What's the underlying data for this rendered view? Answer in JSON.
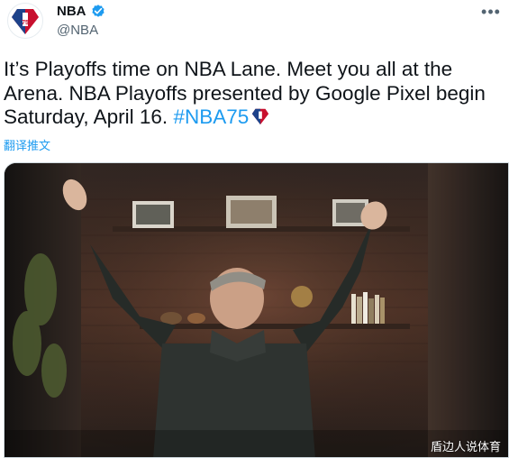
{
  "account": {
    "display_name": "NBA",
    "handle": "@NBA",
    "verified": true,
    "avatar_icon": "nba-75th-logo-icon"
  },
  "tweet": {
    "text_before": "It’s Playoffs time on NBA Lane. Meet you all at the Arena. NBA Playoffs presented by Google Pixel begin Saturday, April 16. ",
    "hashtag": "#NBA75",
    "hashtag_emoji": "nba75-diamond-emoji",
    "translate_label": "翻译推文"
  },
  "media": {
    "type": "video-frame",
    "watermark": "盾边人说体育"
  },
  "colors": {
    "link": "#1d9bf0",
    "text": "#0f1419",
    "secondary": "#536471",
    "verified": "#1d9bf0"
  }
}
